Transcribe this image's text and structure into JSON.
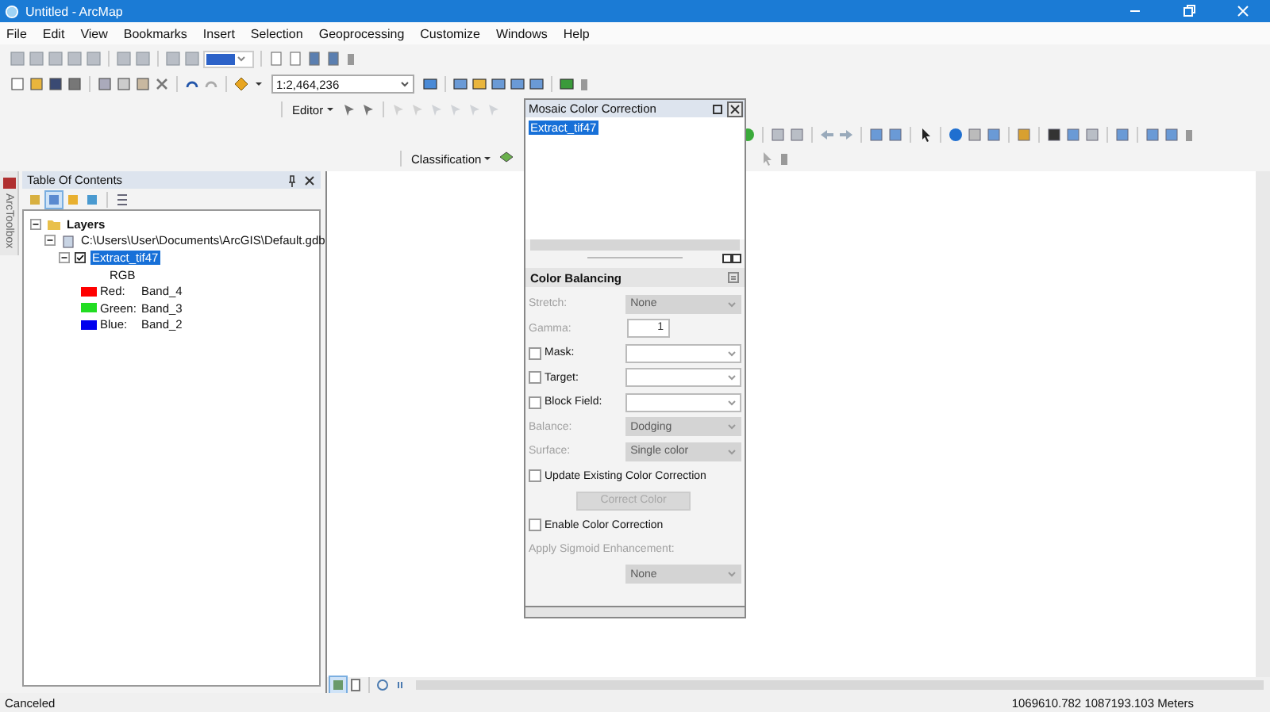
{
  "window": {
    "title": "Untitled - ArcMap"
  },
  "menu": [
    "File",
    "Edit",
    "View",
    "Bookmarks",
    "Insert",
    "Selection",
    "Geoprocessing",
    "Customize",
    "Windows",
    "Help"
  ],
  "toolbars": {
    "scale": "1:2,464,236",
    "editor": "Editor",
    "classification": "Classification"
  },
  "arctoolbox_tab": "ArcToolbox",
  "toc": {
    "title": "Table Of Contents",
    "tree": [
      {
        "label": "Layers",
        "expanded": true,
        "children": [
          {
            "label": "C:\\Users\\User\\Documents\\ArcGIS\\Default.gdb",
            "expanded": true,
            "children": [
              {
                "label": "Extract_tif47",
                "checked": true,
                "selected": true,
                "expanded": true,
                "heading": "RGB",
                "bands": [
                  {
                    "label": "Red:",
                    "value": "Band_4",
                    "color": "#ff0000"
                  },
                  {
                    "label": "Green:",
                    "value": "Band_3",
                    "color": "#22dd22"
                  },
                  {
                    "label": "Blue:",
                    "value": "Band_2",
                    "color": "#0000ee"
                  }
                ]
              }
            ]
          }
        ]
      }
    ]
  },
  "mosaic": {
    "title": "Mosaic Color Correction",
    "items": [
      {
        "label": "Extract_tif47",
        "selected": true
      }
    ],
    "section": "Color Balancing",
    "controls": [
      {
        "kind": "select",
        "label": "Stretch:",
        "value": "None",
        "disabled": true
      },
      {
        "kind": "number",
        "label": "Gamma:",
        "value": "1",
        "disabled": true
      },
      {
        "kind": "check-select",
        "label": "Mask:",
        "checked": false
      },
      {
        "kind": "check-select",
        "label": "Target:",
        "checked": false
      },
      {
        "kind": "check-select",
        "label": "Block Field:",
        "checked": false
      },
      {
        "kind": "select",
        "label": "Balance:",
        "value": "Dodging",
        "disabled": true
      },
      {
        "kind": "select",
        "label": "Surface:",
        "value": "Single color",
        "disabled": true
      },
      {
        "kind": "checkbox",
        "label": "Update Existing Color Correction",
        "checked": false
      },
      {
        "kind": "button",
        "label": "Correct Color",
        "disabled": true
      },
      {
        "kind": "checkbox",
        "label": "Enable Color Correction",
        "checked": false
      },
      {
        "kind": "caption",
        "label": "Apply Sigmoid Enhancement:",
        "disabled": true
      },
      {
        "kind": "select",
        "value": "None",
        "disabled": true
      }
    ]
  },
  "status_bar": {
    "message": "Canceled",
    "coordinates": "1069610.782  1087193.103 Meters"
  }
}
